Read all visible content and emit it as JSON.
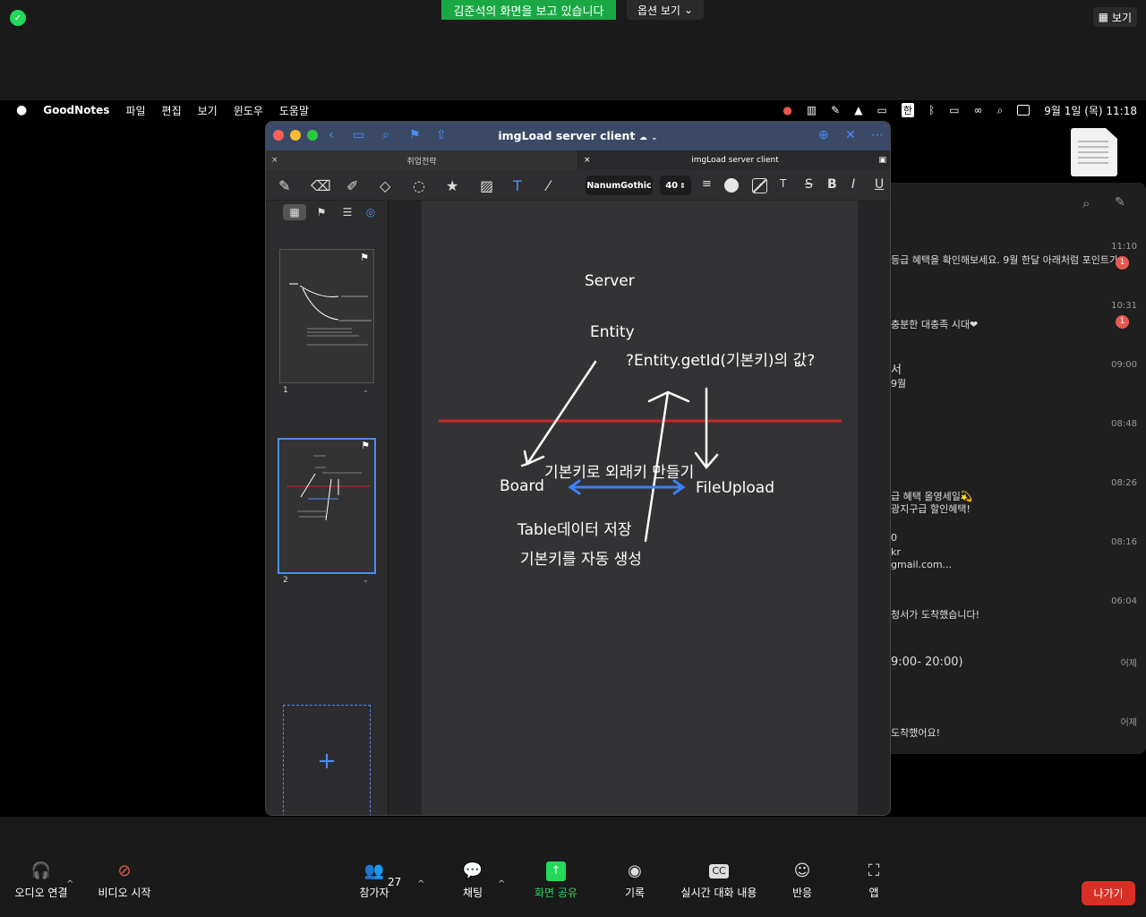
{
  "zoom": {
    "sharing_banner": "김준석의 화면을 보고 있습니다",
    "view_options": "옵션 보기",
    "view_button": "보기",
    "bottom": {
      "audio": "오디오 연결",
      "video": "비디오 시작",
      "participants": "참가자",
      "participants_count": "27",
      "chat": "채팅",
      "share": "화면 공유",
      "record": "기록",
      "captions": "실시간 대화 내용",
      "reactions": "반응",
      "apps": "앱",
      "leave": "나가기"
    }
  },
  "mac_menubar": {
    "app": "GoodNotes",
    "items": [
      "파일",
      "편집",
      "보기",
      "윈도우",
      "도움말"
    ],
    "datetime": "9월 1일 (목)  11:18",
    "hangul": "한"
  },
  "goodnotes": {
    "title": "imgLoad server client",
    "tabs": [
      "취업전략",
      "imgLoad server client"
    ],
    "font": "NanumGothic",
    "size": "40",
    "thumb_numbers": [
      "1",
      "2"
    ],
    "page_texts": {
      "server": "Server",
      "entity": "Entity",
      "question": "?Entity.getId(기본키)의 값?",
      "board": "Board",
      "fk": "기본키로 외래키 만들기",
      "fileupload": "FileUpload",
      "table": "Table데이터 저장",
      "autogen": "기본키를 자동 생성"
    }
  },
  "bg_window": {
    "rows": [
      {
        "time": "11:10",
        "text": "등급 혜택을 확인해보세요. 9월 한달 아래처럼 포인트가",
        "badge": "1"
      },
      {
        "time": "10:31",
        "text": "충분한 대충족 시대❤",
        "badge": "1"
      },
      {
        "time": "09:00",
        "text": "서",
        "text2": "9월"
      },
      {
        "time": "08:48",
        "text": ""
      },
      {
        "time": "08:26",
        "text": "급 혜택 올영세일💫",
        "text2": "광지구급 할인혜택!"
      },
      {
        "time": "08:16",
        "text": "0",
        "text2": "kr",
        "text3": "gmail.com..."
      },
      {
        "time": "06:04",
        "text": "청서가 도착했습니다!"
      },
      {
        "time": "어제",
        "text": "9:00- 20:00)"
      },
      {
        "time": "어제",
        "text": "도착했어요!"
      }
    ]
  }
}
